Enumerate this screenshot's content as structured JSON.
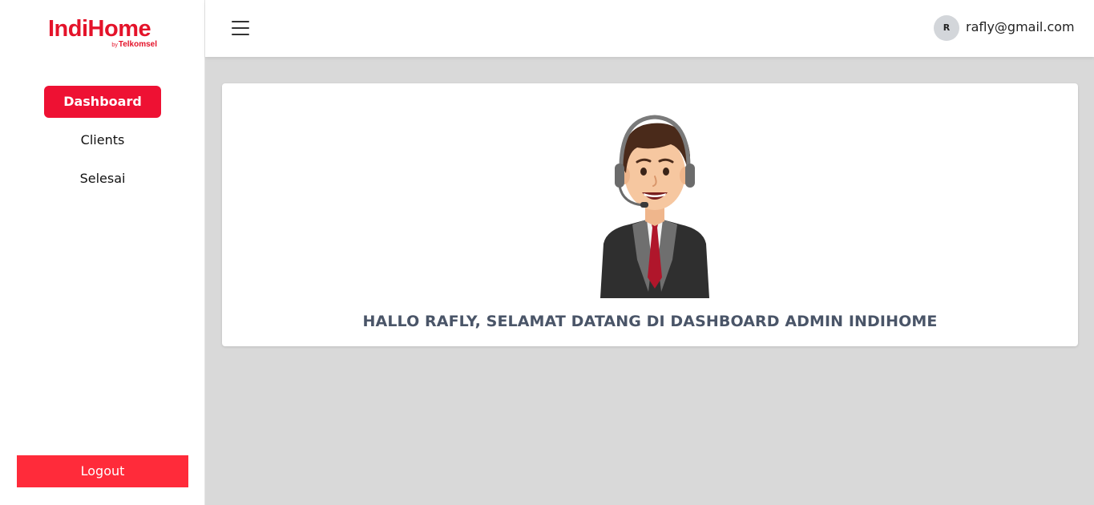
{
  "brand": {
    "logo_text": "IndiHome",
    "logo_by": "by",
    "logo_sub": "Telkomsel",
    "accent": "#e4132a"
  },
  "sidebar": {
    "items": [
      {
        "label": "Dashboard",
        "active": true
      },
      {
        "label": "Clients",
        "active": false
      },
      {
        "label": "Selesai",
        "active": false
      }
    ],
    "logout_label": "Logout"
  },
  "header": {
    "menu_icon": "hamburger-menu-icon",
    "avatar_initial": "R",
    "user_email": "rafly@gmail.com"
  },
  "main": {
    "illustration": "customer-service-agent-illustration",
    "welcome_text": "HALLO RAFLY, SELAMAT DATANG DI DASHBOARD ADMIN INDIHOME"
  }
}
